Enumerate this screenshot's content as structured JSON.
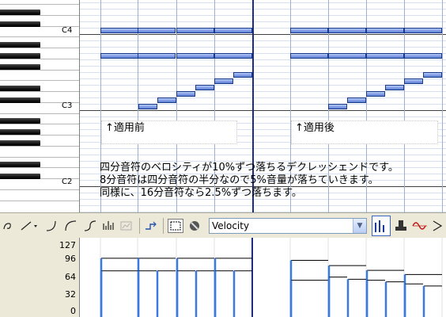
{
  "piano": {
    "octave_labels": [
      "C4",
      "C3",
      "C2"
    ]
  },
  "annotations": {
    "before_label": "↑適用前",
    "after_label": "↑適用後",
    "description": [
      "四分音符のベロシティが10%ずつ落ちるデクレッシェンドです。",
      "8分音符は四分音符の半分なので5%音量が落ちていきます。",
      "同様に、16分音符なら2.5%ずつ落ちます。"
    ]
  },
  "toolbar": {
    "controller_select": "Velocity",
    "icons": [
      "draw-tool-icon",
      "line-tool-icon",
      "curve-tool-icon",
      "s-curve-tool-icon",
      "pitch-curve-tool-icon",
      "random-tool-icon",
      "disabled-tool-icon",
      "quantize-tool-icon",
      "rect-select-icon",
      "eraser-icon",
      "velocity-bar-icon",
      "stamp-icon",
      "sine-wave-icon",
      "arrow-icon"
    ]
  },
  "velocity_scale": [
    "127",
    "96",
    "64",
    "32",
    "0"
  ],
  "colors": {
    "note": "#5b7ed6",
    "velocity_bar": "#3b78e0",
    "grid": "#d6e2f4",
    "bar_line": "#1c2c80"
  }
}
